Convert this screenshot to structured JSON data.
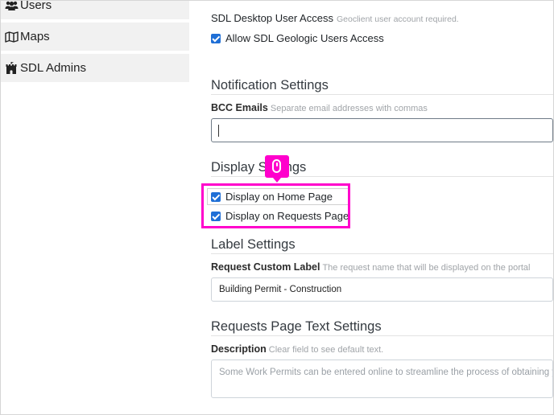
{
  "sidebar": {
    "items": [
      {
        "label": "Users",
        "icon": "users-icon"
      },
      {
        "label": "Maps",
        "icon": "map-icon"
      },
      {
        "label": "SDL Admins",
        "icon": "castle-icon"
      }
    ]
  },
  "access": {
    "desktop_label": "SDL Desktop User Access",
    "desktop_hint": "Geoclient user account required.",
    "allow_geologic_label": "Allow SDL Geologic Users Access",
    "allow_geologic_checked": true
  },
  "notification": {
    "title": "Notification Settings",
    "bcc_label": "BCC Emails",
    "bcc_hint": "Separate email addresses with commas",
    "bcc_value": ""
  },
  "display": {
    "title": "Display Settings",
    "home_label": "Display on Home Page",
    "home_checked": true,
    "requests_label": "Display on Requests Page",
    "requests_checked": true
  },
  "label_settings": {
    "title": "Label Settings",
    "custom_label": "Request Custom Label",
    "custom_hint": "The request name that will be displayed on the portal",
    "custom_value": "Building Permit - Construction"
  },
  "requests_text": {
    "title": "Requests Page Text Settings",
    "description_label": "Description",
    "description_hint": "Clear field to see default text.",
    "description_placeholder": "Some Work Permits can be entered online to streamline the process of obtaining your"
  },
  "colors": {
    "highlight": "#ff00cc",
    "checkbox": "#1f6fd6",
    "sidebar_bg": "#f1f1f1"
  }
}
